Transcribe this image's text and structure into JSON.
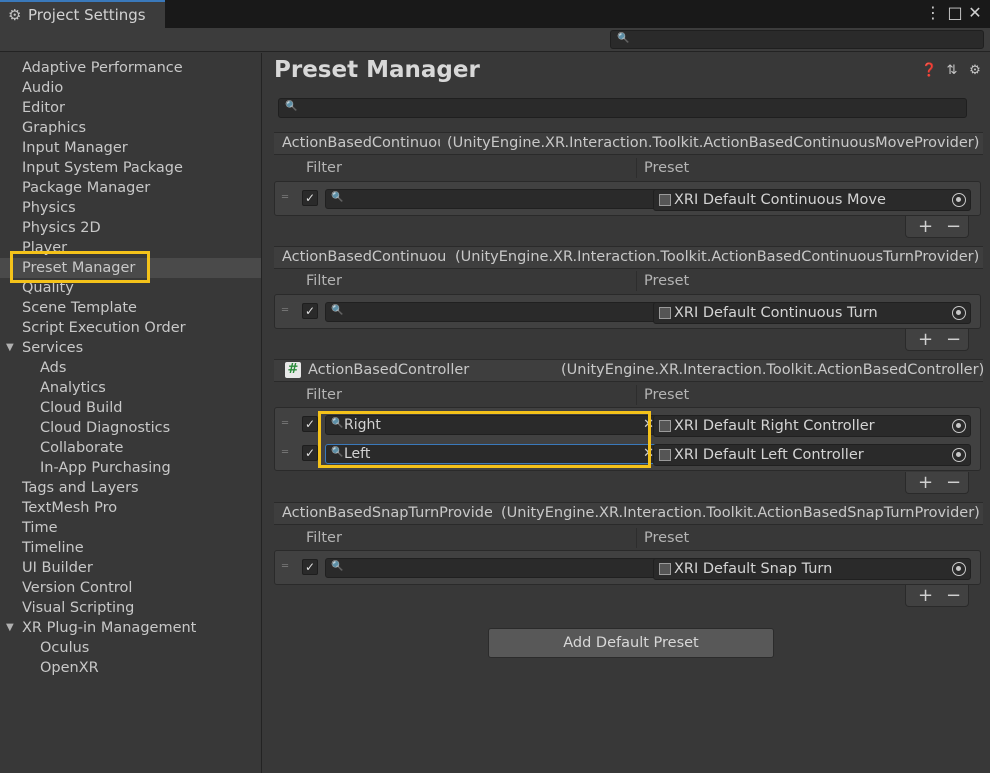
{
  "window": {
    "title": "Project Settings",
    "search_placeholder": ""
  },
  "sidebar": {
    "items": [
      {
        "label": "Adaptive Performance"
      },
      {
        "label": "Audio"
      },
      {
        "label": "Editor"
      },
      {
        "label": "Graphics"
      },
      {
        "label": "Input Manager"
      },
      {
        "label": "Input System Package"
      },
      {
        "label": "Package Manager"
      },
      {
        "label": "Physics"
      },
      {
        "label": "Physics 2D"
      },
      {
        "label": "Player"
      },
      {
        "label": "Preset Manager"
      },
      {
        "label": "Quality"
      },
      {
        "label": "Scene Template"
      },
      {
        "label": "Script Execution Order"
      },
      {
        "label": "Services"
      },
      {
        "label": "Ads"
      },
      {
        "label": "Analytics"
      },
      {
        "label": "Cloud Build"
      },
      {
        "label": "Cloud Diagnostics"
      },
      {
        "label": "Collaborate"
      },
      {
        "label": "In-App Purchasing"
      },
      {
        "label": "Tags and Layers"
      },
      {
        "label": "TextMesh Pro"
      },
      {
        "label": "Time"
      },
      {
        "label": "Timeline"
      },
      {
        "label": "UI Builder"
      },
      {
        "label": "Version Control"
      },
      {
        "label": "Visual Scripting"
      },
      {
        "label": "XR Plug-in Management"
      },
      {
        "label": "Oculus"
      },
      {
        "label": "OpenXR"
      }
    ],
    "selected": "Preset Manager"
  },
  "main": {
    "title": "Preset Manager",
    "column_filter": "Filter",
    "column_preset": "Preset",
    "groups": [
      {
        "type_short": "ActionBasedContinuou",
        "type_full": "(UnityEngine.XR.Interaction.Toolkit.ActionBasedContinuousMoveProvider)",
        "rows": [
          {
            "filter": "",
            "preset": "XRI Default Continuous Move"
          }
        ]
      },
      {
        "type_short": "ActionBasedContinuou",
        "type_full": "(UnityEngine.XR.Interaction.Toolkit.ActionBasedContinuousTurnProvider)",
        "rows": [
          {
            "filter": "",
            "preset": "XRI Default Continuous Turn"
          }
        ]
      },
      {
        "type_short": "ActionBasedController",
        "type_full": "(UnityEngine.XR.Interaction.Toolkit.ActionBasedController)",
        "rows": [
          {
            "filter": "Right",
            "preset": "XRI Default Right Controller"
          },
          {
            "filter": "Left",
            "preset": "XRI Default Left Controller"
          }
        ]
      },
      {
        "type_short": "ActionBasedSnapTurnProvide",
        "type_full": "(UnityEngine.XR.Interaction.Toolkit.ActionBasedSnapTurnProvider)",
        "rows": [
          {
            "filter": "",
            "preset": "XRI Default Snap Turn"
          }
        ]
      }
    ],
    "add_default_label": "Add Default Preset"
  },
  "colors": {
    "highlight": "#f4c21a",
    "background": "#383838",
    "titlebar": "#191919"
  }
}
